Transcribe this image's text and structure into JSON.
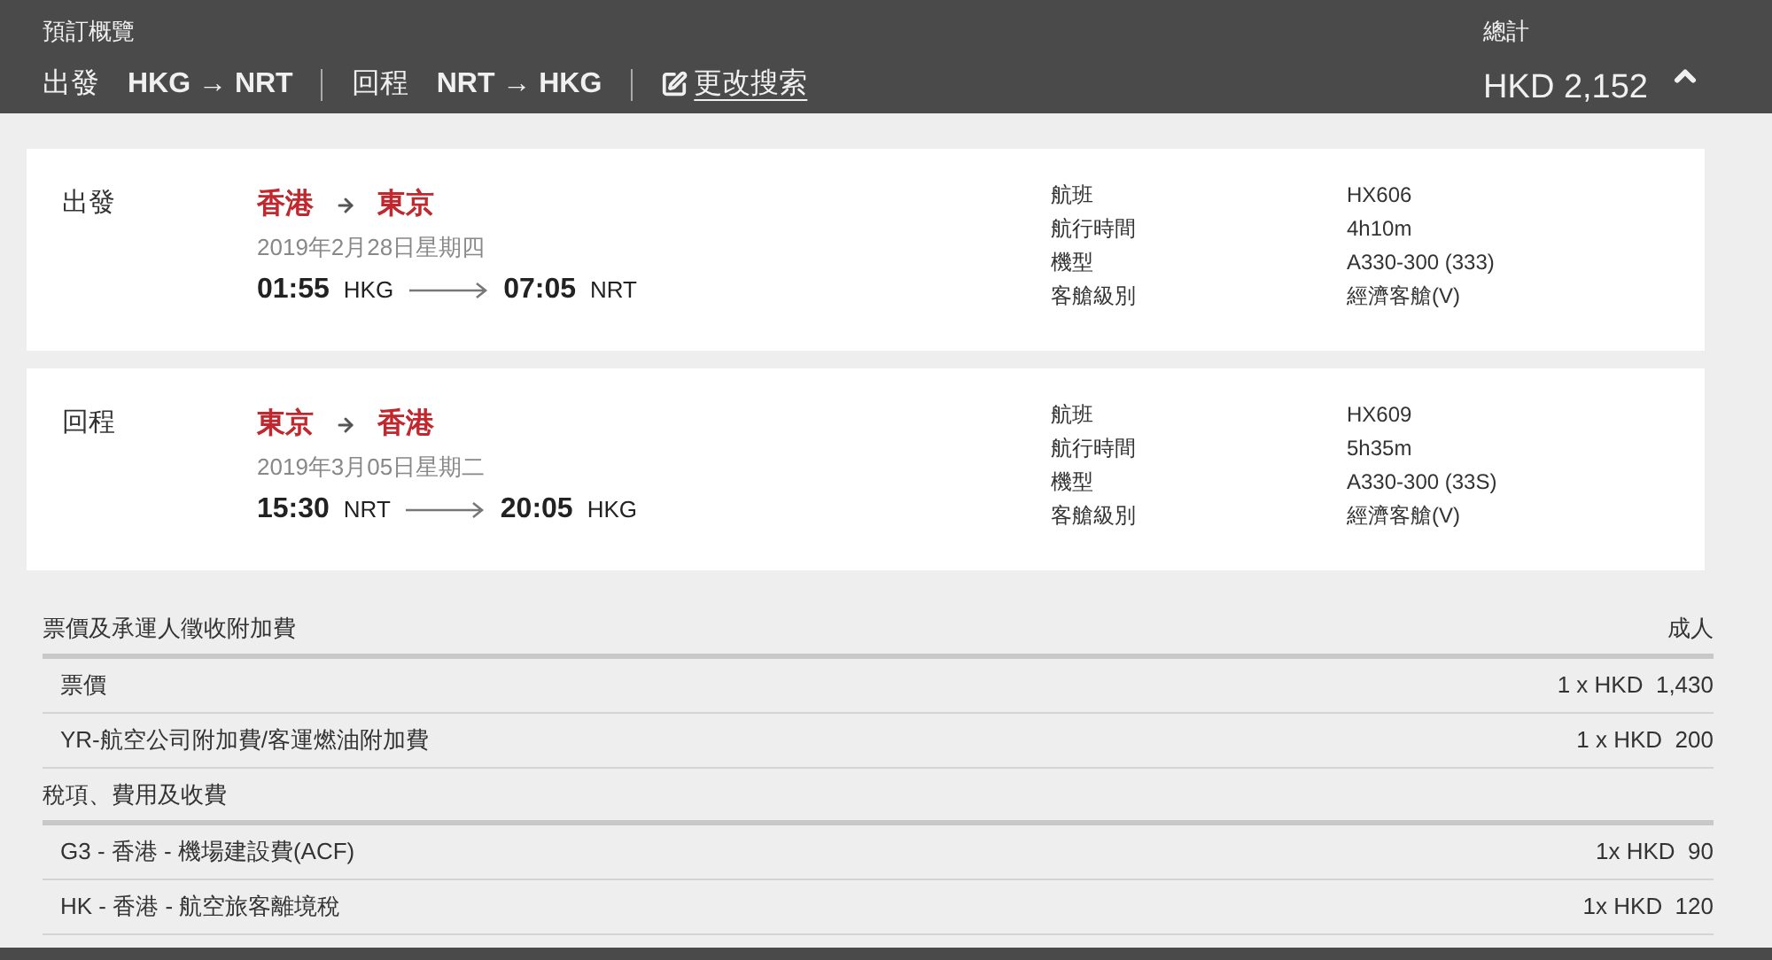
{
  "header": {
    "title": "預訂概覽",
    "legs": [
      {
        "label": "出發",
        "route": "HKG → NRT"
      },
      {
        "label": "回程",
        "route": "NRT → HKG"
      }
    ],
    "edit_link": "更改搜索",
    "total_label": "總計",
    "total": "HKD 2,152",
    "expanded": true
  },
  "flights": [
    {
      "label": "出發",
      "from_city": "香港",
      "to_city": "東京",
      "date": "2019年2月28日星期四",
      "dep_time": "01:55",
      "dep_code": "HKG",
      "arr_time": "07:05",
      "arr_code": "NRT",
      "details": [
        {
          "label": "航班",
          "value": "HX606"
        },
        {
          "label": "航行時間",
          "value": "4h10m"
        },
        {
          "label": "機型",
          "value": "A330-300 (333)"
        },
        {
          "label": "客艙級別",
          "value": "經濟客艙(V)"
        }
      ]
    },
    {
      "label": "回程",
      "from_city": "東京",
      "to_city": "香港",
      "date": "2019年3月05日星期二",
      "dep_time": "15:30",
      "dep_code": "NRT",
      "arr_time": "20:05",
      "arr_code": "HKG",
      "details": [
        {
          "label": "航班",
          "value": "HX609"
        },
        {
          "label": "航行時間",
          "value": "5h35m"
        },
        {
          "label": "機型",
          "value": "A330-300 (33S)"
        },
        {
          "label": "客艙級別",
          "value": "經濟客艙(V)"
        }
      ]
    }
  ],
  "price_sections": [
    {
      "title": "票價及承運人徵收附加費",
      "column": "成人",
      "items": [
        {
          "name": "票價",
          "amount": "1 x HKD  1,430"
        },
        {
          "name": "YR-航空公司附加費/客運燃油附加費",
          "amount": "1 x HKD  200"
        }
      ]
    },
    {
      "title": "稅項、費用及收費",
      "items": [
        {
          "name": "G3 - 香港 - 機場建設費(ACF)",
          "amount": "1x HKD  90"
        },
        {
          "name": "HK - 香港 - 航空旅客離境稅",
          "amount": "1x HKD  120"
        }
      ]
    }
  ]
}
